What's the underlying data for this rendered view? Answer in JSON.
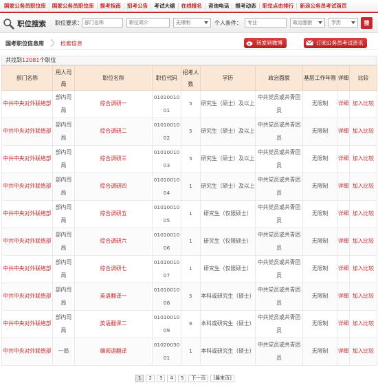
{
  "nav": [
    "国家公务员职位库",
    "国家公务员职位库",
    "报考指南",
    "招考公告",
    "考试大纲",
    "在线报名",
    "咨询电话",
    "报考动态",
    "职位点击排行",
    "新浪公务员考试首页"
  ],
  "search": {
    "title": "职位搜索",
    "req_label": "职位要求：",
    "dept_placeholder": "部门名称",
    "job_placeholder": "职位简介",
    "limit_select": "无限制",
    "personal_label": "个人条件：",
    "major_placeholder": "专业",
    "politics_select": "政治面貌",
    "edu_select": "学历",
    "btn": "搜"
  },
  "breadcrumb": {
    "home": "国考职位信息库",
    "current": "检索信息"
  },
  "actions": {
    "weibo": "转发到微博",
    "subscribe": "订阅公务员考试资讯"
  },
  "count": {
    "prefix": "共找到",
    "number": "12081",
    "suffix": "个职位"
  },
  "table": {
    "headers": [
      "部门名称",
      "用人司局",
      "职位名称",
      "职位代码",
      "招考人数",
      "学历",
      "政治面貌",
      "基层工作年限",
      "详细",
      "比较"
    ],
    "rows": [
      {
        "dept": "中共中央对外联络部",
        "bureau": "部内司局",
        "name": "综合调研一",
        "code": "0101001001",
        "num": "5",
        "edu": "研究生（硕士）及以上",
        "pol": "中共党员或共青团员",
        "years": "无限制",
        "detail": "详细",
        "compare": "加入比较"
      },
      {
        "dept": "中共中央对外联络部",
        "bureau": "部内司局",
        "name": "综合调研二",
        "code": "0101001002",
        "num": "5",
        "edu": "研究生（硕士）及以上",
        "pol": "中共党员或共青团员",
        "years": "无限制",
        "detail": "详细",
        "compare": "加入比较"
      },
      {
        "dept": "中共中央对外联络部",
        "bureau": "部内司局",
        "name": "综合调研三",
        "code": "0101001003",
        "num": "5",
        "edu": "研究生（硕士）及以上",
        "pol": "中共党员或共青团员",
        "years": "无限制",
        "detail": "详细",
        "compare": "加入比较"
      },
      {
        "dept": "中共中央对外联络部",
        "bureau": "部内司局",
        "name": "综合调研四",
        "code": "0101001004",
        "num": "1",
        "edu": "研究生（硕士）及以上",
        "pol": "中共党员或共青团员",
        "years": "无限制",
        "detail": "详细",
        "compare": "加入比较"
      },
      {
        "dept": "中共中央对外联络部",
        "bureau": "部内司局",
        "name": "综合调研五",
        "code": "0101001005",
        "num": "1",
        "edu": "研究生（仅限硕士）",
        "pol": "中共党员或共青团员",
        "years": "无限制",
        "detail": "详细",
        "compare": "加入比较"
      },
      {
        "dept": "中共中央对外联络部",
        "bureau": "部内司局",
        "name": "综合调研六",
        "code": "0101001006",
        "num": "1",
        "edu": "研究生（仅限硕士）",
        "pol": "中共党员或共青团员",
        "years": "无限制",
        "detail": "详细",
        "compare": "加入比较"
      },
      {
        "dept": "中共中央对外联络部",
        "bureau": "部内司局",
        "name": "综合调研七",
        "code": "0101001007",
        "num": "1",
        "edu": "研究生（仅限硕士）",
        "pol": "中共党员或共青团员",
        "years": "无限制",
        "detail": "详细",
        "compare": "加入比较"
      },
      {
        "dept": "中共中央对外联络部",
        "bureau": "部内司局",
        "name": "英语翻译一",
        "code": "0101001008",
        "num": "5",
        "edu": "本科或研究生（硕士）",
        "pol": "中共党员或共青团员",
        "years": "无限制",
        "detail": "详细",
        "compare": "加入比较"
      },
      {
        "dept": "中共中央对外联络部",
        "bureau": "部内司局",
        "name": "英语翻译二",
        "code": "0101001009",
        "num": "6",
        "edu": "本科或研究生（硕士）",
        "pol": "中共党员或共青团员",
        "years": "无限制",
        "detail": "详细",
        "compare": "加入比较"
      },
      {
        "dept": "中共中央对外联络部",
        "bureau": "一局",
        "name": "编阅语翻译",
        "code": "0102003001",
        "num": "1",
        "edu": "本科或研究生（硕士）",
        "pol": "中共党员或共青团员",
        "years": "无限制",
        "detail": "详细",
        "compare": "加入比较"
      }
    ]
  },
  "pagination": {
    "pages": [
      "1",
      "2",
      "3",
      "4",
      "5"
    ],
    "current": "1",
    "next": "下一页",
    "last": "[最末页]"
  }
}
